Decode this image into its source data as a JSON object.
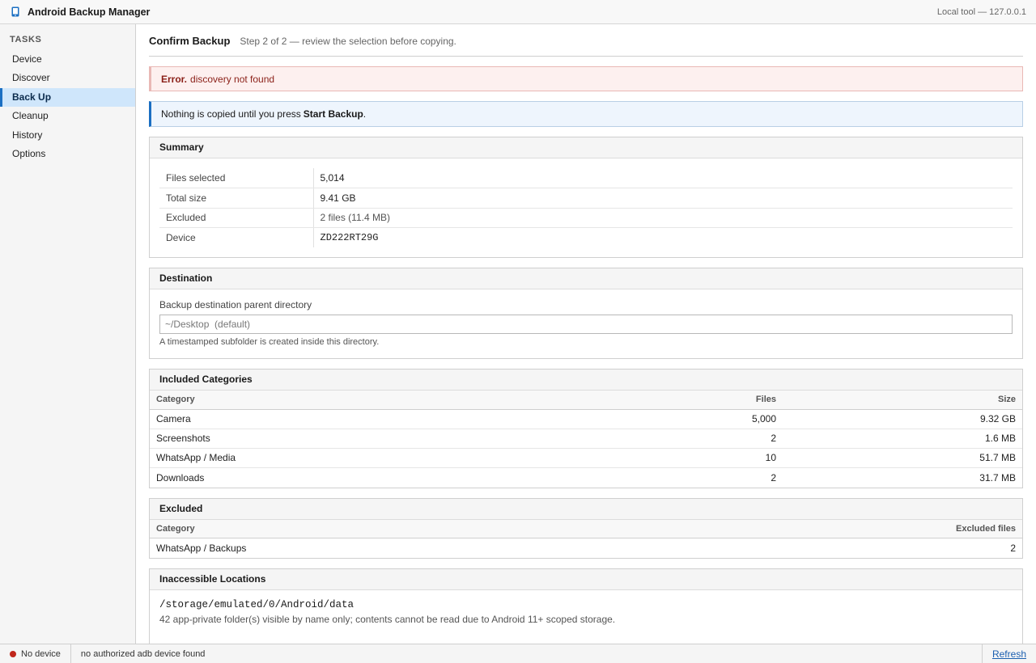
{
  "window": {
    "title": "Android Backup Manager",
    "right_info": "Local tool — 127.0.0.1",
    "icon": "phone-icon",
    "accent_color": "#1b6fc2"
  },
  "sidebar": {
    "section_title": "TASKS",
    "items": [
      {
        "label": "Device"
      },
      {
        "label": "Discover"
      },
      {
        "label": "Back Up",
        "active": true
      },
      {
        "label": "Cleanup"
      },
      {
        "label": "History"
      },
      {
        "label": "Options"
      }
    ]
  },
  "page": {
    "title": "Confirm Backup",
    "subtitle": "Step 2 of 2 — review the selection before copying."
  },
  "error": {
    "prefix": "Error.",
    "message": "discovery not found",
    "color": "#8a1f17"
  },
  "info": {
    "text": "Nothing is copied until you press",
    "emphasis": "Start Backup",
    "suffix": "."
  },
  "summary": {
    "title": "Summary",
    "rows": [
      {
        "label": "Files selected",
        "value": "5,014"
      },
      {
        "label": "Total size",
        "value": "9.41 GB"
      },
      {
        "label": "Excluded",
        "value": "2 files (11.4 MB)"
      },
      {
        "label": "Device",
        "value": "ZD222RT29G"
      }
    ]
  },
  "destination": {
    "title": "Destination",
    "field_label": "Backup destination parent directory",
    "placeholder": "~/Desktop  (default)",
    "hint": "A timestamped subfolder is created inside this directory."
  },
  "included": {
    "title": "Included Categories",
    "columns": [
      "Category",
      "Files",
      "Size"
    ],
    "rows": [
      {
        "category": "Camera",
        "files": "5,000",
        "size": "9.32 GB"
      },
      {
        "category": "Screenshots",
        "files": "2",
        "size": "1.6 MB"
      },
      {
        "category": "WhatsApp / Media",
        "files": "10",
        "size": "51.7 MB"
      },
      {
        "category": "Downloads",
        "files": "2",
        "size": "31.7 MB"
      }
    ]
  },
  "excluded": {
    "title": "Excluded",
    "columns": [
      "Category",
      "Excluded files"
    ],
    "rows": [
      {
        "category": "WhatsApp / Backups",
        "count": "2"
      }
    ]
  },
  "inaccessible": {
    "title": "Inaccessible Locations",
    "path": "/storage/emulated/0/Android/data",
    "description": "42 app-private folder(s) visible by name only; contents cannot be read due to Android 11+ scoped storage."
  },
  "statusbar": {
    "device_status": "No device",
    "status_color": "#c0261b",
    "message": "no authorized adb device found",
    "refresh_label": "Refresh"
  }
}
